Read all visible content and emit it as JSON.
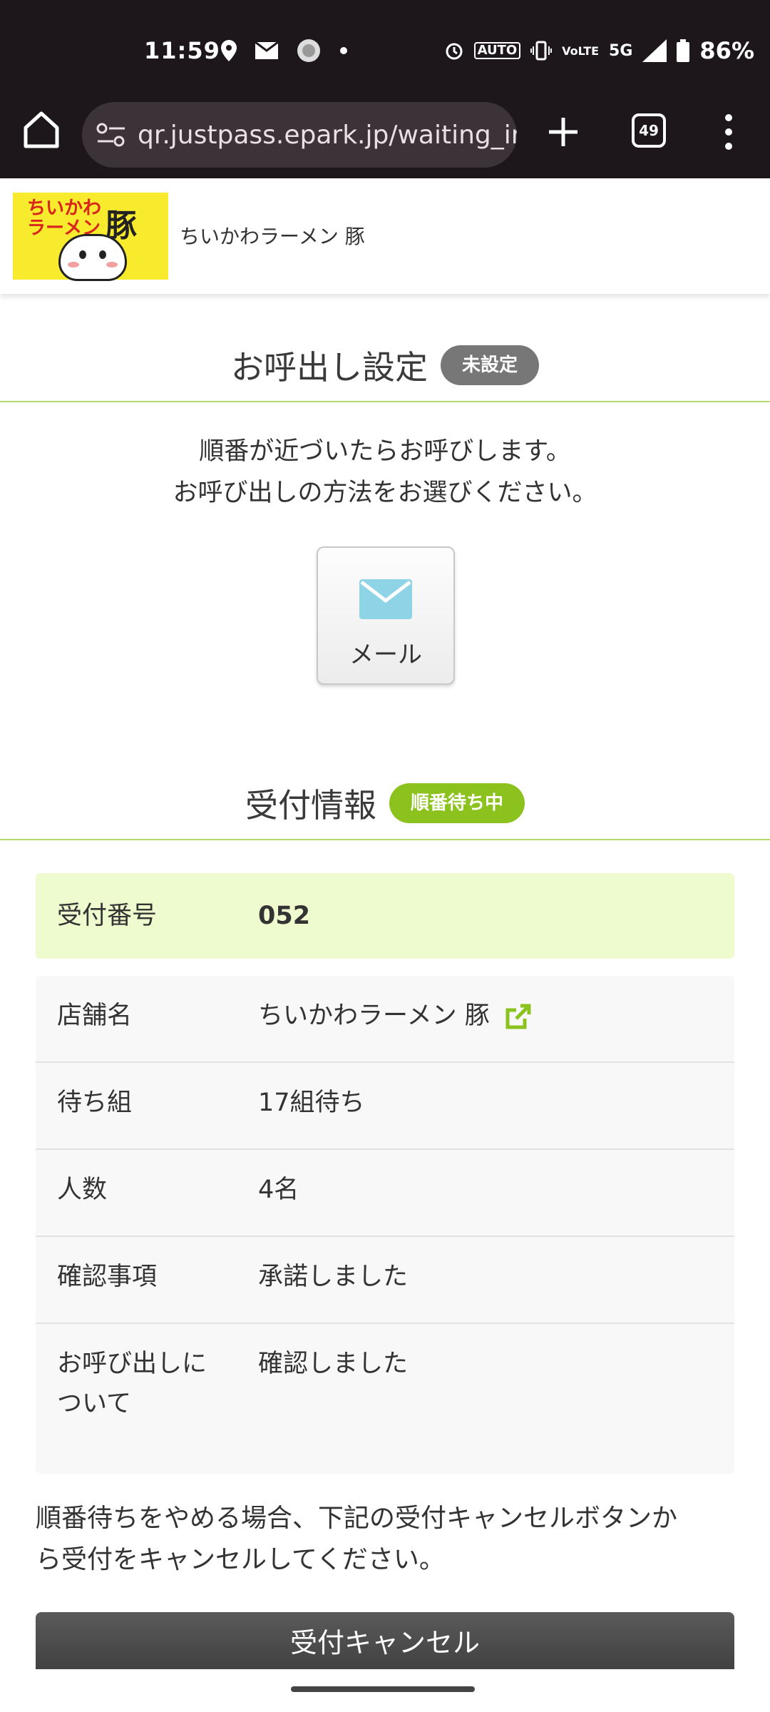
{
  "status_bar": {
    "time": "11:59",
    "battery": "86%",
    "network": "5G",
    "auto_label": "AUTO",
    "volte_label": "VoLTE"
  },
  "browser": {
    "url": "qr.justpass.epark.jp/waiting_ir",
    "tab_count": "49"
  },
  "header": {
    "logo_text_small": "ちいかわ\nラーメン",
    "logo_text_big": "豚",
    "shop_name": "ちいかわラーメン 豚"
  },
  "call_section": {
    "title": "お呼出し設定",
    "badge": "未設定",
    "description_line1": "順番が近づいたらお呼びします。",
    "description_line2": "お呼び出しの方法をお選びください。",
    "mail_button_label": "メール"
  },
  "reception_section": {
    "title": "受付情報",
    "badge": "順番待ち中",
    "number_label": "受付番号",
    "number_value": "052",
    "rows": [
      {
        "label": "店舗名",
        "value": "ちいかわラーメン 豚"
      },
      {
        "label": "待ち組",
        "value": "17組待ち"
      },
      {
        "label": "人数",
        "value": "4名"
      },
      {
        "label": "確認事項",
        "value": "承諾しました"
      },
      {
        "label": "お呼び出しに\nついて",
        "value": "確認しました"
      }
    ]
  },
  "cancel": {
    "note_line1": "順番待ちをやめる場合、下記の受付キャンセルボタンか",
    "note_line2": "ら受付をキャンセルしてください。",
    "button_label": "受付キャンセル"
  },
  "colors": {
    "accent_green": "#8cc21e",
    "badge_gray": "#777777",
    "highlight_bg": "#eefbcf",
    "chrome_bg": "#1d171b",
    "mail_icon": "#8fd3e6"
  }
}
